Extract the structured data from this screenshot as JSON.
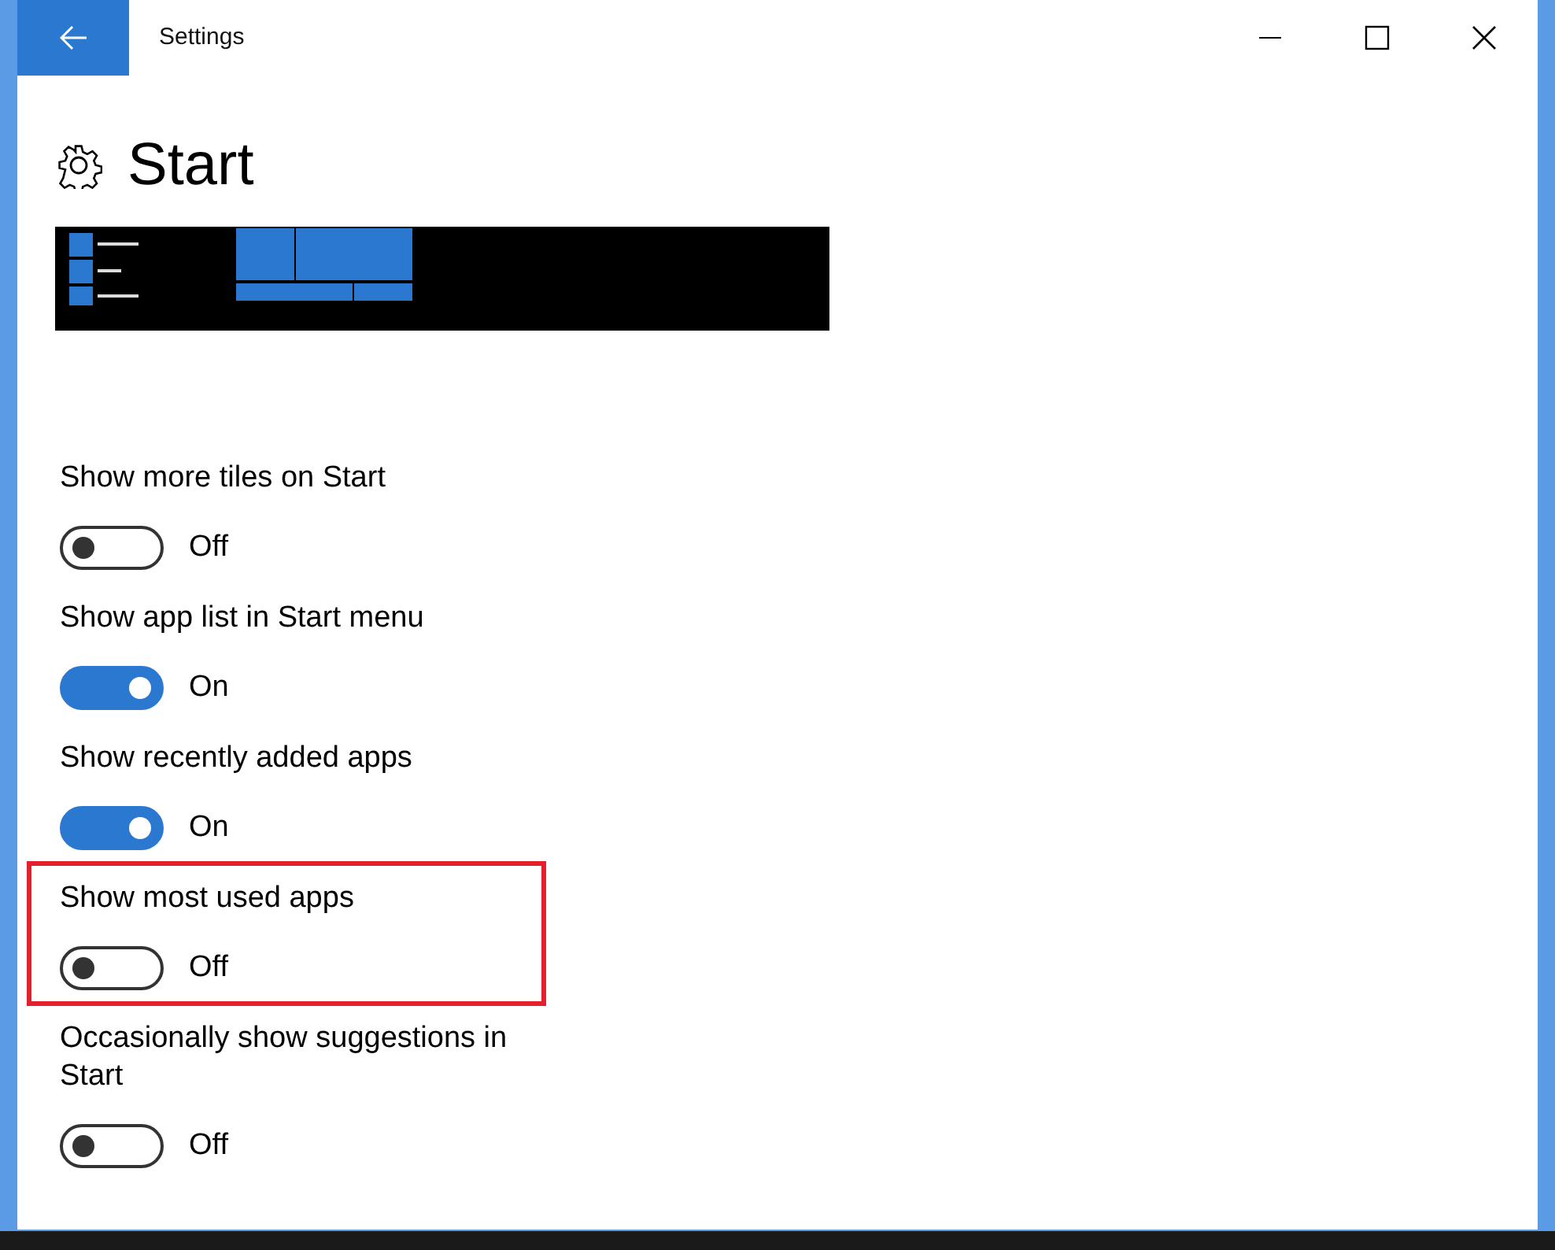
{
  "window": {
    "title": "Settings"
  },
  "page": {
    "title": "Start"
  },
  "settings": [
    {
      "label": "Show more tiles on Start",
      "on": false,
      "state_text": "Off",
      "highlighted": false
    },
    {
      "label": "Show app list in Start menu",
      "on": true,
      "state_text": "On",
      "highlighted": false
    },
    {
      "label": "Show recently added apps",
      "on": true,
      "state_text": "On",
      "highlighted": false
    },
    {
      "label": "Show most used apps",
      "on": false,
      "state_text": "Off",
      "highlighted": true
    },
    {
      "label": "Occasionally show suggestions in Start",
      "on": false,
      "state_text": "Off",
      "highlighted": false
    }
  ]
}
